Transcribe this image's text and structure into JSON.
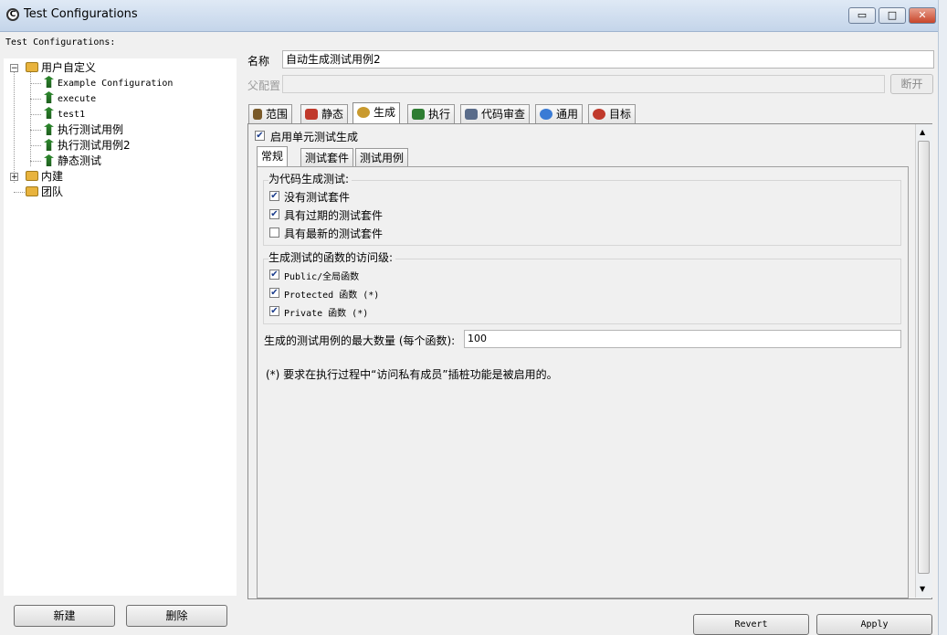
{
  "window": {
    "title": "Test Configurations",
    "minimize": "▭",
    "maximize": "□",
    "close": "✕"
  },
  "left": {
    "heading": "Test Configurations:",
    "tree": [
      {
        "label": "用户自定义",
        "expander": "−"
      },
      {
        "label": "Example Configuration"
      },
      {
        "label": "execute"
      },
      {
        "label": "test1"
      },
      {
        "label": "执行测试用例"
      },
      {
        "label": "执行测试用例2"
      },
      {
        "label": "静态测试"
      },
      {
        "label": "内建",
        "expander": "+"
      },
      {
        "label": "团队"
      }
    ],
    "new_button": "新建",
    "delete_button": "删除"
  },
  "form": {
    "name_label": "名称",
    "name_value": "自动生成测试用例2",
    "parent_label": "父配置",
    "parent_value": "",
    "break_button": "断开"
  },
  "tabs": [
    {
      "label": "范围",
      "icon": "wrench-icon",
      "color": "#7a5a2a"
    },
    {
      "label": "静态",
      "icon": "static-icon",
      "color": "#c0392b"
    },
    {
      "label": "生成",
      "icon": "gear-icon",
      "color": "#c99a2e"
    },
    {
      "label": "执行",
      "icon": "run-icon",
      "color": "#2e7d32"
    },
    {
      "label": "代码审查",
      "icon": "review-icon",
      "color": "#5a6c8a"
    },
    {
      "label": "通用",
      "icon": "people-icon",
      "color": "#3a7bd5"
    },
    {
      "label": "目标",
      "icon": "target-icon",
      "color": "#c0392b"
    }
  ],
  "generate": {
    "enable_label": "启用单元测试生成",
    "enable_checked": true,
    "subtabs": [
      "常规",
      "测试套件",
      "测试用例"
    ],
    "group1": {
      "title": "为代码生成测试:",
      "options": [
        {
          "label": "没有测试套件",
          "checked": true
        },
        {
          "label": "具有过期的测试套件",
          "checked": true
        },
        {
          "label": "具有最新的测试套件",
          "checked": false
        }
      ]
    },
    "group2": {
      "title": "生成测试的函数的访问级:",
      "options": [
        {
          "label": "Public/全局函数",
          "checked": true
        },
        {
          "label": "Protected 函数 (*)",
          "checked": true
        },
        {
          "label": "Private 函数 (*)",
          "checked": true
        }
      ]
    },
    "max_label": "生成的测试用例的最大数量 (每个函数):",
    "max_value": "100",
    "note": "(*) 要求在执行过程中“访问私有成员”插桩功能是被启用的。"
  },
  "bottom": {
    "revert": "Revert",
    "apply": "Apply"
  }
}
